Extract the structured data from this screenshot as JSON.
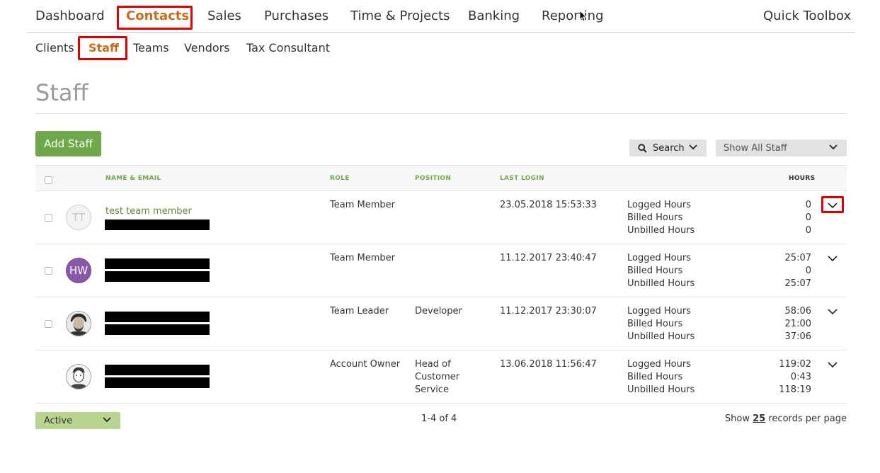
{
  "top_nav": {
    "items": [
      {
        "label": "Dashboard"
      },
      {
        "label": "Contacts"
      },
      {
        "label": "Sales"
      },
      {
        "label": "Purchases"
      },
      {
        "label": "Time & Projects"
      },
      {
        "label": "Banking"
      },
      {
        "label": "Reporting"
      }
    ],
    "active": "Contacts",
    "quick_toolbox": "Quick Toolbox"
  },
  "sub_nav": {
    "items": [
      {
        "label": "Clients"
      },
      {
        "label": "Staff"
      },
      {
        "label": "Teams"
      },
      {
        "label": "Vendors"
      },
      {
        "label": "Tax Consultant"
      }
    ],
    "active": "Staff"
  },
  "page": {
    "title": "Staff",
    "add_button": "Add Staff",
    "search_button": "Search",
    "filter_select": "Show All Staff"
  },
  "table": {
    "headers": {
      "name_email": "NAME & EMAIL",
      "role": "ROLE",
      "position": "POSITION",
      "last_login": "LAST LOGIN",
      "hours": "HOURS"
    },
    "hour_labels": [
      "Logged Hours",
      "Billed Hours",
      "Unbilled Hours"
    ],
    "rows": [
      {
        "avatar_initials": "TT",
        "name": "test team member",
        "role": "Team Member",
        "position_lines": [
          "",
          "",
          ""
        ],
        "last_login": "23.05.2018 15:53:33",
        "logged": "0",
        "billed": "0",
        "unbilled": "0"
      },
      {
        "avatar_initials": "HW",
        "name": "",
        "role": "Team Member",
        "position_lines": [
          "",
          "",
          ""
        ],
        "last_login": "11.12.2017 23:40:47",
        "logged": "25:07",
        "billed": "0",
        "unbilled": "25:07"
      },
      {
        "avatar_initials": "",
        "name": "",
        "role": "Team Leader",
        "position_lines": [
          "Developer",
          "",
          ""
        ],
        "last_login": "11.12.2017 23:30:07",
        "logged": "58:06",
        "billed": "21:00",
        "unbilled": "37:06"
      },
      {
        "avatar_initials": "",
        "name": "",
        "role": "Account Owner",
        "position_lines": [
          "Head of",
          "Customer",
          "Service"
        ],
        "last_login": "13.06.2018 11:56:47",
        "logged": "119:02",
        "billed": "0:43",
        "unbilled": "118:19"
      }
    ]
  },
  "footer": {
    "status_select": "Active",
    "pagination": "1-4 of 4",
    "per_page_prefix": "Show",
    "per_page_value": "25",
    "per_page_suffix": "records per page"
  },
  "colors": {
    "active_nav": "#c86d1e",
    "highlight": "#e00000",
    "add_button": "#6fa84a",
    "link": "#5d8a2e",
    "status_select": "#b8d48f"
  }
}
